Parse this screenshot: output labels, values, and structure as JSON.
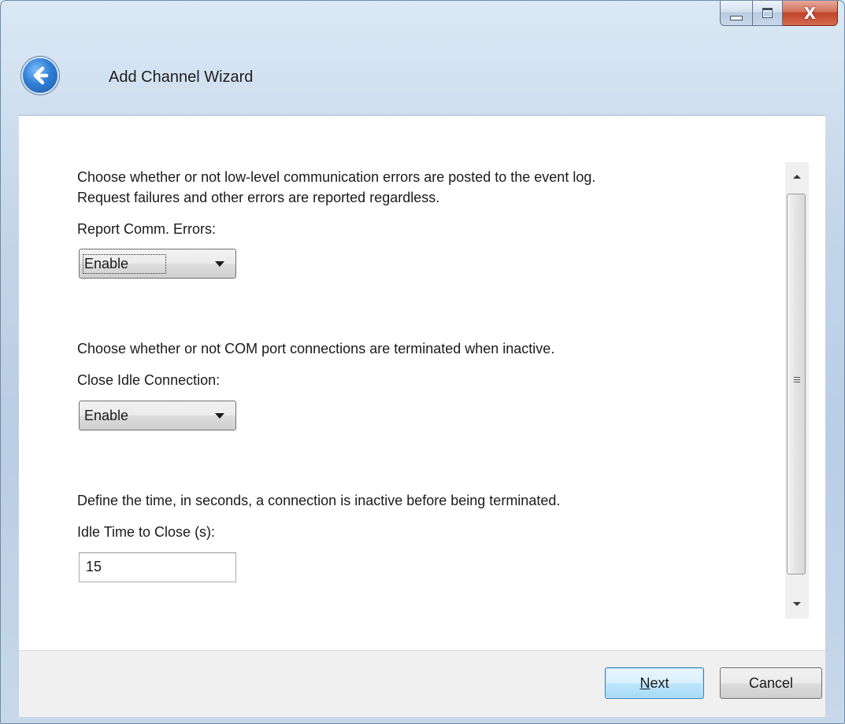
{
  "window": {
    "title": "Add Channel Wizard",
    "controls": {
      "minimize_icon": "minimize-icon",
      "maximize_icon": "maximize-icon",
      "close_label": "X"
    },
    "back_icon": "back-arrow-icon"
  },
  "sections": [
    {
      "description_line1": "Choose whether or not low-level communication errors are posted to the event log.",
      "description_line2": "Request failures and other errors are reported regardless.",
      "label": "Report Comm. Errors:",
      "value": "Enable"
    },
    {
      "description_line1": "Choose whether or not COM port connections are terminated when inactive.",
      "label": "Close Idle Connection:",
      "value": "Enable"
    },
    {
      "description_line1": "Define the time, in seconds, a connection is inactive before being terminated.",
      "label": "Idle Time to Close (s):",
      "value": "15"
    }
  ],
  "buttons": {
    "next_mnemonic": "N",
    "next_rest": "ext",
    "cancel": "Cancel"
  },
  "colors": {
    "accent": "#3c7fb1",
    "close_button": "#c1432a"
  }
}
